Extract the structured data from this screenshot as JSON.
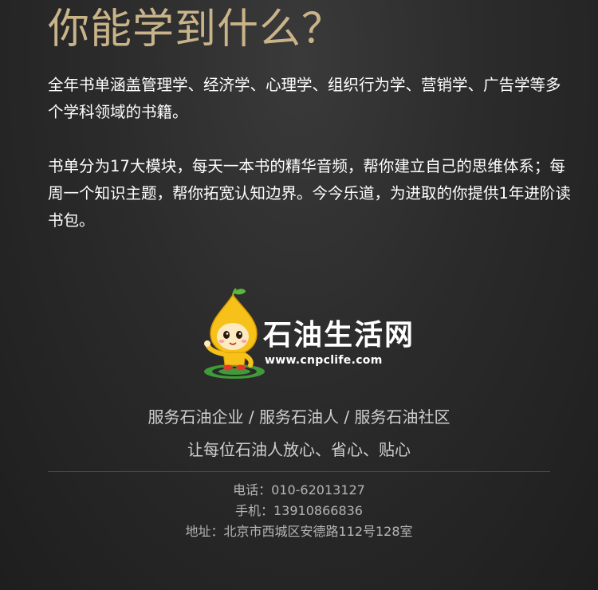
{
  "hero": {
    "title": "你能学到什么？"
  },
  "intro": {
    "paragraph_1": "全年书单涵盖管理学、经济学、心理学、组织行为学、营销学、广告学等多个学科领域的书籍。",
    "paragraph_2": "书单分为17大模块，每天一本书的精华音频，帮你建立自己的思维体系；每周一个知识主题，帮你拓宽认知边界。今今乐道，为进取的你提供1年进阶读书包。"
  },
  "logo": {
    "name": "石油生活网",
    "url": "www.cnpclife.com",
    "mascot_icon": "drop-mascot-icon"
  },
  "slogans": {
    "line_1": "服务石油企业 / 服务石油人 / 服务石油社区",
    "line_2": "让每位石油人放心、省心、贴心"
  },
  "contact": {
    "phone": "电话：010-62013127",
    "mobile": "手机：13910866836",
    "address": "地址：北京市西城区安德路112号128室"
  },
  "colors": {
    "title_gold": "#c9b48a",
    "background": "#2b2b2b",
    "mascot_yellow": "#f6c21a",
    "mascot_leaf": "#5db83a",
    "ring_green": "#3f9b3a"
  }
}
